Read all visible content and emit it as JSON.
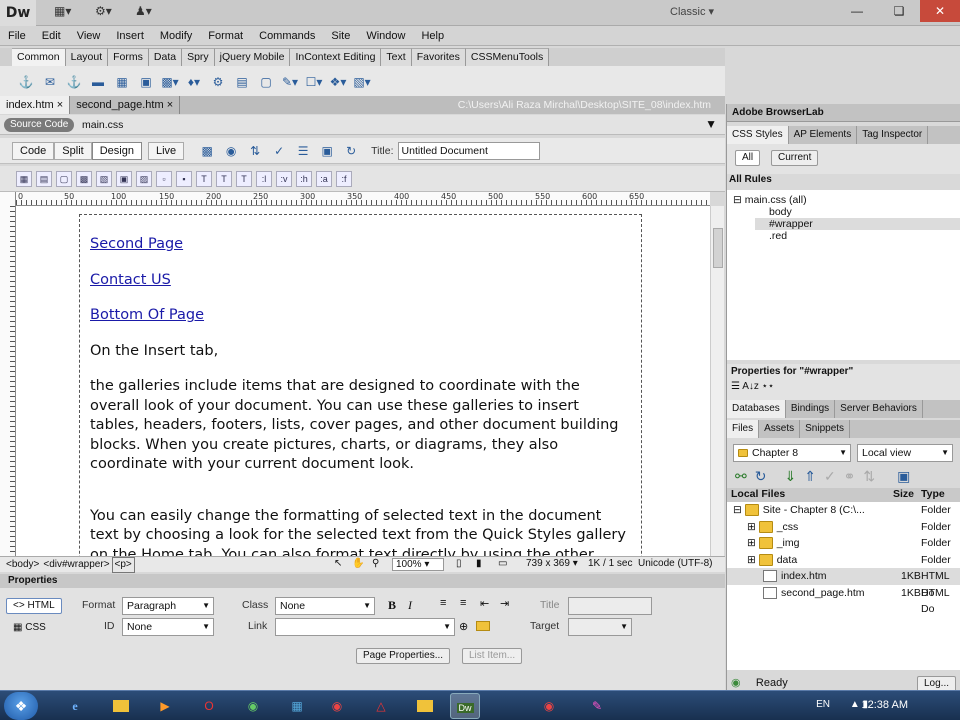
{
  "app": {
    "logo": "Dw",
    "workspace": "Classic",
    "icons": [
      "layout-icon",
      "gear-icon",
      "user-icon"
    ]
  },
  "window_controls": {
    "minimize": "—",
    "restore": "❏",
    "close": "✕"
  },
  "menu": [
    "File",
    "Edit",
    "View",
    "Insert",
    "Modify",
    "Format",
    "Commands",
    "Site",
    "Window",
    "Help"
  ],
  "insert_tabs": [
    "Common",
    "Layout",
    "Forms",
    "Data",
    "Spry",
    "jQuery Mobile",
    "InContext Editing",
    "Text",
    "Favorites",
    "CSSMenuTools"
  ],
  "doc_tabs": [
    "index.htm",
    "second_page.htm"
  ],
  "doc_path": "C:\\Users\\Ali Raza Mirchal\\Desktop\\SITE_08\\index.htm",
  "related": {
    "source": "Source Code",
    "file": "main.css"
  },
  "view_buttons": [
    "Code",
    "Split",
    "Design",
    "Live"
  ],
  "title_label": "Title:",
  "title_value": "Untitled Document",
  "format_buttons": [
    ":l",
    ":v",
    ":h",
    ":a",
    ":f"
  ],
  "ruler_ticks": [
    "0",
    "50",
    "100",
    "150",
    "200",
    "250",
    "300",
    "350",
    "400",
    "450",
    "500",
    "550",
    "600",
    "650"
  ],
  "document": {
    "links": [
      "Second Page",
      "Contact US",
      "Bottom Of Page"
    ],
    "paragraphs": [
      "On the Insert tab,",
      "the galleries include items that are designed to coordinate with the overall look of your document. You can use these galleries to insert tables, headers, footers, lists, cover pages, and other document building blocks. When you create pictures, charts, or diagrams, they also coordinate with your current document look.",
      "You can easily change the formatting of selected text in the document text by choosing a look for the selected text from the Quick Styles gallery on the Home tab. You can also format text directly by using the other controls on the Home tab. Most controls offer a choice of using the look from the current theme or using a format that you specify directly."
    ]
  },
  "status": {
    "tags": [
      "<body>",
      "<div#wrapper>",
      "<p>"
    ],
    "zoom": "100%",
    "size": "739 x 369",
    "download": "1K / 1 sec",
    "encoding": "Unicode (UTF-8)"
  },
  "properties": {
    "header": "Properties",
    "html_btn": "HTML",
    "css_btn": "CSS",
    "format_label": "Format",
    "format_value": "Paragraph",
    "id_label": "ID",
    "id_value": "None",
    "class_label": "Class",
    "class_value": "None",
    "link_label": "Link",
    "title_label": "Title",
    "target_label": "Target",
    "bold": "B",
    "italic": "I",
    "page_props": "Page Properties...",
    "list_item": "List Item..."
  },
  "right_panel": {
    "browserlab": "Adobe BrowserLab",
    "css_tabs": [
      "CSS Styles",
      "AP Elements",
      "Tag Inspector"
    ],
    "mode_buttons": [
      "All",
      "Current"
    ],
    "all_rules": "All Rules",
    "rules": [
      "main.css (all)",
      "body",
      "#wrapper",
      ".red"
    ],
    "props_for": "Properties for \"#wrapper\"",
    "db_tabs": [
      "Databases",
      "Bindings",
      "Server Behaviors"
    ],
    "files_tabs": [
      "Files",
      "Assets",
      "Snippets"
    ],
    "site_select": "Chapter 8",
    "view_select": "Local view",
    "cols": [
      "Local Files",
      "Size",
      "Type"
    ],
    "files": [
      {
        "name": "Site - Chapter 8 (C:\\...",
        "size": "",
        "type": "Folder",
        "indent": 0,
        "kind": "folder"
      },
      {
        "name": "_css",
        "size": "",
        "type": "Folder",
        "indent": 1,
        "kind": "folder"
      },
      {
        "name": "_img",
        "size": "",
        "type": "Folder",
        "indent": 1,
        "kind": "folder"
      },
      {
        "name": "data",
        "size": "",
        "type": "Folder",
        "indent": 1,
        "kind": "folder"
      },
      {
        "name": "index.htm",
        "size": "1KB",
        "type": "HTML Do",
        "indent": 1,
        "kind": "html"
      },
      {
        "name": "second_page.htm",
        "size": "1KB",
        "type": "HTML Do",
        "indent": 1,
        "kind": "html"
      }
    ],
    "ready": "Ready",
    "log_btn": "Log..."
  },
  "taskbar": {
    "lang": "EN",
    "time": "12:38 AM",
    "apps": [
      "ie",
      "explorer",
      "media",
      "opera",
      "chrome",
      "acrobat",
      "folder",
      "dreamweaver",
      "chrome2",
      "paint"
    ]
  }
}
